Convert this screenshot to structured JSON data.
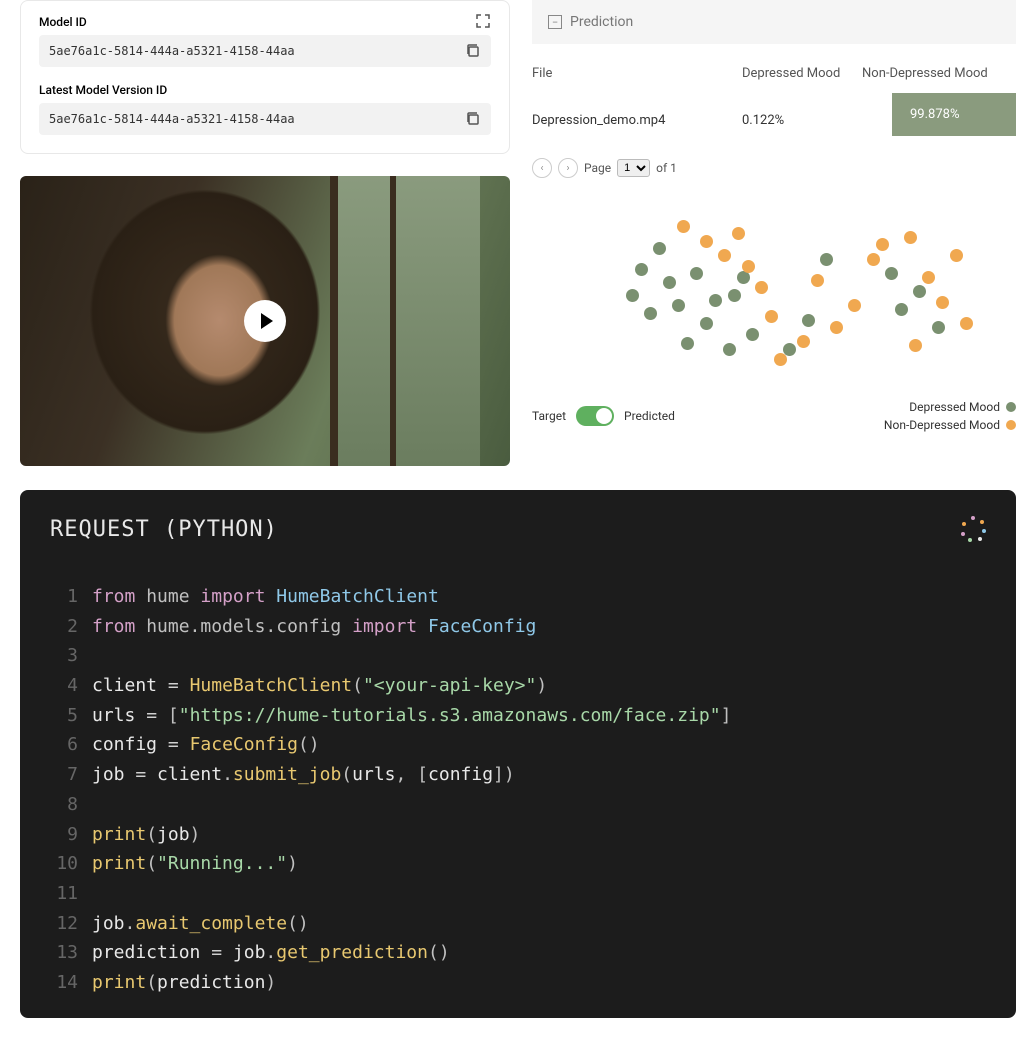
{
  "model_card": {
    "model_id_label": "Model ID",
    "model_id_value": "5ae76a1c-5814-444a-a5321-4158-44aa",
    "version_id_label": "Latest Model Version ID",
    "version_id_value": "5ae76a1c-5814-444a-a5321-4158-44aa"
  },
  "prediction_panel": {
    "title": "Prediction",
    "cols": {
      "file": "File",
      "dep": "Depressed Mood",
      "nondep": "Non-Depressed Mood"
    },
    "row": {
      "file": "Depression_demo.mp4",
      "dep": "0.122%",
      "nondep": "99.878%"
    },
    "pager": {
      "page_label": "Page",
      "current": "1",
      "of_label": "of 1"
    }
  },
  "scatter_legend": {
    "target": "Target",
    "predicted": "Predicted",
    "class_a": "Depressed Mood",
    "class_b": "Non-Depressed Mood"
  },
  "chart_data": {
    "type": "scatter",
    "title": "",
    "xlabel": "",
    "ylabel": "",
    "xlim": [
      0,
      100
    ],
    "ylim": [
      0,
      100
    ],
    "series": [
      {
        "name": "Depressed Mood",
        "color": "#7a9070",
        "points": [
          [
            18,
            48
          ],
          [
            20,
            62
          ],
          [
            22,
            38
          ],
          [
            24,
            74
          ],
          [
            26,
            55
          ],
          [
            28,
            42
          ],
          [
            30,
            21
          ],
          [
            32,
            60
          ],
          [
            34,
            32
          ],
          [
            36,
            45
          ],
          [
            39,
            18
          ],
          [
            40,
            48
          ],
          [
            42,
            58
          ],
          [
            44,
            26
          ],
          [
            60,
            68
          ],
          [
            56,
            34
          ],
          [
            52,
            18
          ],
          [
            74,
            60
          ],
          [
            76,
            40
          ],
          [
            80,
            50
          ],
          [
            84,
            30
          ]
        ]
      },
      {
        "name": "Non-Depressed Mood",
        "color": "#f0a850",
        "points": [
          [
            29,
            86
          ],
          [
            34,
            78
          ],
          [
            38,
            70
          ],
          [
            41,
            82
          ],
          [
            43,
            64
          ],
          [
            46,
            52
          ],
          [
            48,
            36
          ],
          [
            50,
            12
          ],
          [
            55,
            22
          ],
          [
            58,
            56
          ],
          [
            62,
            30
          ],
          [
            66,
            42
          ],
          [
            70,
            68
          ],
          [
            72,
            76
          ],
          [
            78,
            80
          ],
          [
            82,
            58
          ],
          [
            85,
            44
          ],
          [
            88,
            70
          ],
          [
            90,
            32
          ],
          [
            79,
            20
          ]
        ]
      }
    ]
  },
  "code_block": {
    "title": "REQUEST (PYTHON)",
    "lines": [
      [
        {
          "t": "kw",
          "v": "from"
        },
        {
          "t": "sp"
        },
        {
          "t": "pkg",
          "v": "hume"
        },
        {
          "t": "sp"
        },
        {
          "t": "kw",
          "v": "import"
        },
        {
          "t": "sp"
        },
        {
          "t": "cls",
          "v": "HumeBatchClient"
        }
      ],
      [
        {
          "t": "kw",
          "v": "from"
        },
        {
          "t": "sp"
        },
        {
          "t": "pkg",
          "v": "hume.models.config"
        },
        {
          "t": "sp"
        },
        {
          "t": "kw",
          "v": "import"
        },
        {
          "t": "sp"
        },
        {
          "t": "cls",
          "v": "FaceConfig"
        }
      ],
      [],
      [
        {
          "t": "var",
          "v": "client"
        },
        {
          "t": "sp"
        },
        {
          "t": "op",
          "v": "="
        },
        {
          "t": "sp"
        },
        {
          "t": "fn",
          "v": "HumeBatchClient"
        },
        {
          "t": "pun",
          "v": "("
        },
        {
          "t": "str",
          "v": "\"<your-api-key>\""
        },
        {
          "t": "pun",
          "v": ")"
        }
      ],
      [
        {
          "t": "var",
          "v": "urls"
        },
        {
          "t": "sp"
        },
        {
          "t": "op",
          "v": "="
        },
        {
          "t": "sp"
        },
        {
          "t": "pun",
          "v": "["
        },
        {
          "t": "str",
          "v": "\"https://hume-tutorials.s3.amazonaws.com/face.zip\""
        },
        {
          "t": "pun",
          "v": "]"
        }
      ],
      [
        {
          "t": "var",
          "v": "config"
        },
        {
          "t": "sp"
        },
        {
          "t": "op",
          "v": "="
        },
        {
          "t": "sp"
        },
        {
          "t": "fn",
          "v": "FaceConfig"
        },
        {
          "t": "pun",
          "v": "()"
        }
      ],
      [
        {
          "t": "var",
          "v": "job"
        },
        {
          "t": "sp"
        },
        {
          "t": "op",
          "v": "="
        },
        {
          "t": "sp"
        },
        {
          "t": "var",
          "v": "client"
        },
        {
          "t": "pun",
          "v": "."
        },
        {
          "t": "fn",
          "v": "submit_job"
        },
        {
          "t": "pun",
          "v": "("
        },
        {
          "t": "var",
          "v": "urls"
        },
        {
          "t": "pun",
          "v": ", ["
        },
        {
          "t": "var",
          "v": "config"
        },
        {
          "t": "pun",
          "v": "])"
        }
      ],
      [],
      [
        {
          "t": "fn",
          "v": "print"
        },
        {
          "t": "pun",
          "v": "("
        },
        {
          "t": "var",
          "v": "job"
        },
        {
          "t": "pun",
          "v": ")"
        }
      ],
      [
        {
          "t": "fn",
          "v": "print"
        },
        {
          "t": "pun",
          "v": "("
        },
        {
          "t": "str",
          "v": "\"Running...\""
        },
        {
          "t": "pun",
          "v": ")"
        }
      ],
      [],
      [
        {
          "t": "var",
          "v": "job"
        },
        {
          "t": "pun",
          "v": "."
        },
        {
          "t": "fn",
          "v": "await_complete"
        },
        {
          "t": "pun",
          "v": "()"
        }
      ],
      [
        {
          "t": "var",
          "v": "prediction"
        },
        {
          "t": "sp"
        },
        {
          "t": "op",
          "v": "="
        },
        {
          "t": "sp"
        },
        {
          "t": "var",
          "v": "job"
        },
        {
          "t": "pun",
          "v": "."
        },
        {
          "t": "fn",
          "v": "get_prediction"
        },
        {
          "t": "pun",
          "v": "()"
        }
      ],
      [
        {
          "t": "fn",
          "v": "print"
        },
        {
          "t": "pun",
          "v": "("
        },
        {
          "t": "var",
          "v": "prediction"
        },
        {
          "t": "pun",
          "v": ")"
        }
      ]
    ]
  }
}
